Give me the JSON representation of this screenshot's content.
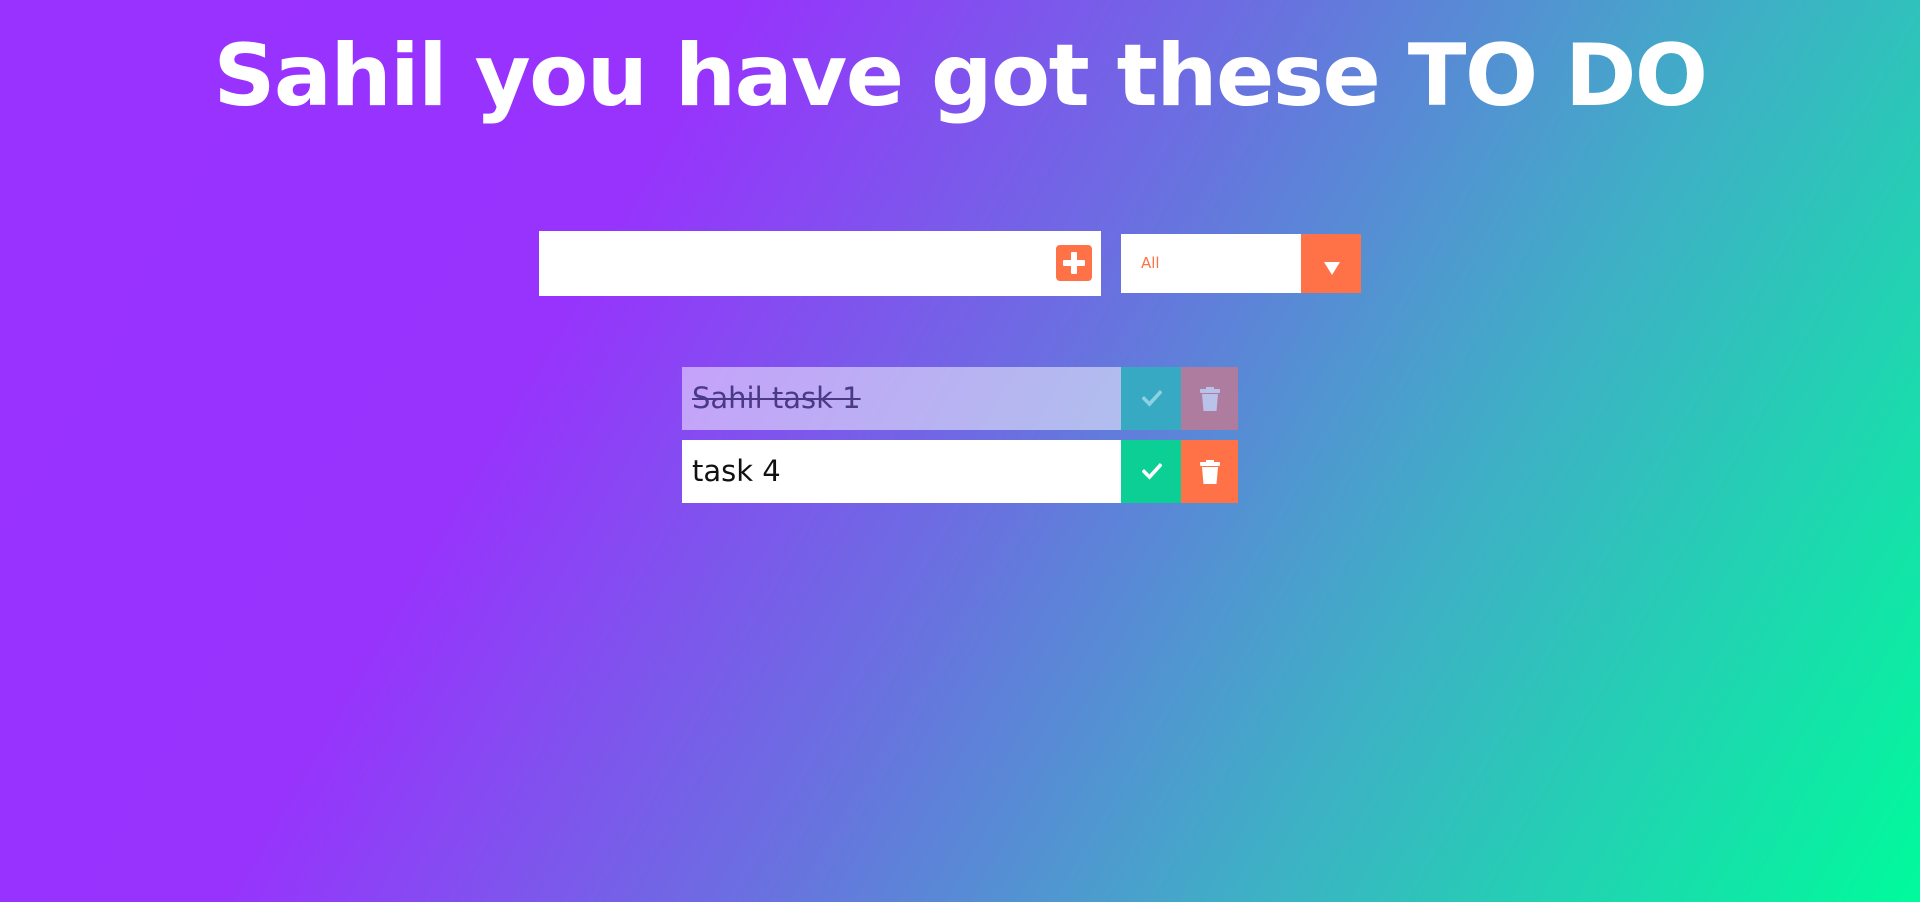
{
  "header": {
    "title": "Sahil you have got these TO DO"
  },
  "form": {
    "input_value": "",
    "input_placeholder": "",
    "add_icon": "plus-square-icon"
  },
  "filter": {
    "selected": "All",
    "arrow_icon": "caret-down-icon"
  },
  "todos": [
    {
      "text": "Sahil task 1",
      "completed": true
    },
    {
      "text": "task 4",
      "completed": false
    }
  ],
  "colors": {
    "accent": "#ff7248",
    "check": "#0ccf96",
    "gradient_start": "#9932ff",
    "gradient_end": "#00fb9b"
  },
  "icons": {
    "check": "check-icon",
    "trash": "trash-icon"
  }
}
